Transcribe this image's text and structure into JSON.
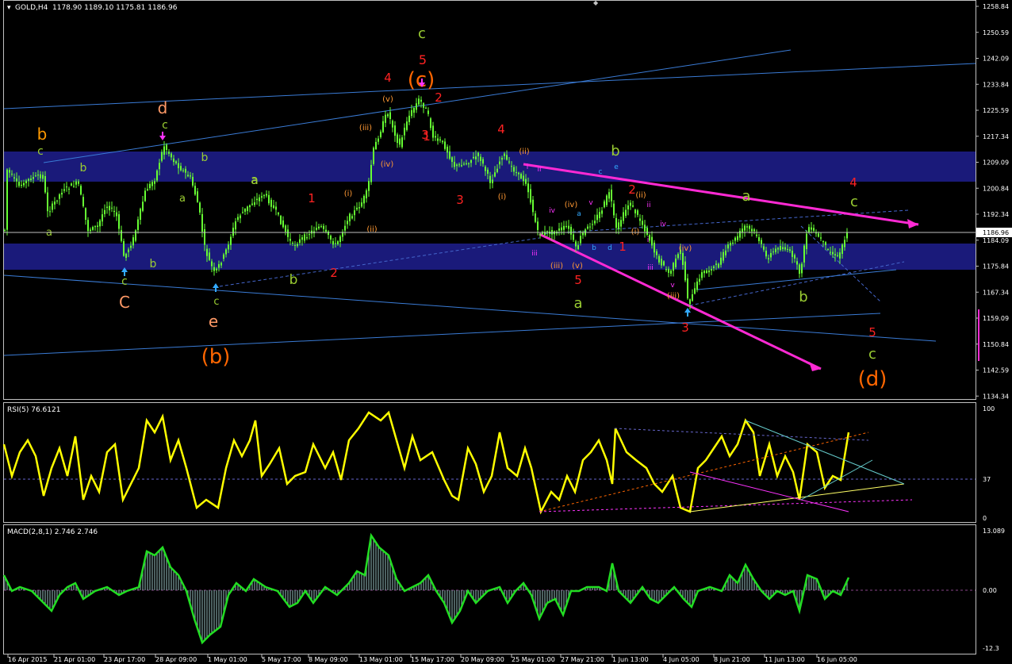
{
  "colors": {
    "background": "#000000",
    "frame": "#c0c0c0",
    "candle": "#66ff33",
    "zone": "#1a1a7a",
    "trend_line": "#3a7bd5",
    "magenta": "#ff2ad4",
    "rsi_line": "#ffff00",
    "macd_line": "#22dd22",
    "macd_hist": "#7fa0a0"
  },
  "main": {
    "title": "GOLD,H4",
    "ohlc": "1178.90 1189.10 1175.81 1186.96",
    "current_price": "1186.96",
    "price_ticks": [
      "1258.84",
      "1250.59",
      "1242.09",
      "1233.84",
      "1225.59",
      "1217.34",
      "1209.09",
      "1200.84",
      "1192.34",
      "1184.09",
      "1175.84",
      "1167.34",
      "1159.09",
      "1150.84",
      "1142.59",
      "1134.34"
    ]
  },
  "rsi": {
    "title": "RSI(5) 76.6121",
    "ticks": [
      "100",
      "37",
      "0"
    ]
  },
  "macd": {
    "title": "MACD(2,8,1) 2.746 2.746",
    "ticks": [
      "13.089",
      "0.00",
      "-12.3"
    ]
  },
  "time_axis": [
    "16 Apr 2015",
    "21 Apr 01:00",
    "23 Apr 17:00",
    "28 Apr 09:00",
    "1 May 01:00",
    "5 May 17:00",
    "8 May 09:00",
    "13 May 01:00",
    "15 May 17:00",
    "20 May 09:00",
    "25 May 01:00",
    "27 May 21:00",
    "1 Jun 13:00",
    "4 Jun 05:00",
    "8 Jun 21:00",
    "11 Jun 13:00",
    "16 Jun 05:00"
  ],
  "wave_labels": [
    {
      "t": "b",
      "c": "#ff9900",
      "s": 20
    },
    {
      "t": "c",
      "c": "#9acd32",
      "s": 14
    },
    {
      "t": "b",
      "c": "#9acd32",
      "s": 14
    },
    {
      "t": "a",
      "c": "#9acd32",
      "s": 13
    },
    {
      "t": "c",
      "c": "#9acd32",
      "s": 14
    },
    {
      "t": "C",
      "c": "#ff9966",
      "s": 20
    },
    {
      "t": "d",
      "c": "#ff9966",
      "s": 20
    },
    {
      "t": "c",
      "c": "#9acd32",
      "s": 14
    },
    {
      "t": "b",
      "c": "#9acd32",
      "s": 14
    },
    {
      "t": "a",
      "c": "#9acd32",
      "s": 13
    },
    {
      "t": "a",
      "c": "#9acd32",
      "s": 14
    },
    {
      "t": "b",
      "c": "#9acd32",
      "s": 14
    },
    {
      "t": "c",
      "c": "#9acd32",
      "s": 13
    },
    {
      "t": "e",
      "c": "#ff9966",
      "s": 20
    },
    {
      "t": "(b)",
      "c": "#ff6600",
      "s": 26
    },
    {
      "t": "a",
      "c": "#9acd32",
      "s": 16
    },
    {
      "t": "b",
      "c": "#9acd32",
      "s": 17
    },
    {
      "t": "1",
      "c": "#ff2222",
      "s": 15
    },
    {
      "t": "2",
      "c": "#ff2222",
      "s": 15
    },
    {
      "t": "(i)",
      "c": "#ff9933",
      "s": 10
    },
    {
      "t": "(ii)",
      "c": "#ff9933",
      "s": 10
    },
    {
      "t": "(iii)",
      "c": "#ff9933",
      "s": 10
    },
    {
      "t": "(iv)",
      "c": "#ff9933",
      "s": 10
    },
    {
      "t": "(v)",
      "c": "#ff9933",
      "s": 10
    },
    {
      "t": "3",
      "c": "#ff2222",
      "s": 15
    },
    {
      "t": "4",
      "c": "#ff2222",
      "s": 15
    },
    {
      "t": "5",
      "c": "#ff2222",
      "s": 16
    },
    {
      "t": "c",
      "c": "#9acd32",
      "s": 18
    },
    {
      "t": "(c)",
      "c": "#ff6600",
      "s": 26
    },
    {
      "t": "2",
      "c": "#ff2222",
      "s": 15
    },
    {
      "t": "1",
      "c": "#ff2222",
      "s": 15
    },
    {
      "t": "3",
      "c": "#ff2222",
      "s": 15
    },
    {
      "t": "4",
      "c": "#ff2222",
      "s": 15
    },
    {
      "t": "(ii)",
      "c": "#ff9933",
      "s": 10
    },
    {
      "t": "(i)",
      "c": "#ff9933",
      "s": 10
    },
    {
      "t": "ii",
      "c": "#ff33ff",
      "s": 9
    },
    {
      "t": "i",
      "c": "#ff33ff",
      "s": 9
    },
    {
      "t": "iii",
      "c": "#ff33ff",
      "s": 9
    },
    {
      "t": "iv",
      "c": "#ff33ff",
      "s": 9
    },
    {
      "t": "v",
      "c": "#ff33ff",
      "s": 9
    },
    {
      "t": "(iv)",
      "c": "#ff9933",
      "s": 10
    },
    {
      "t": "(iii)",
      "c": "#ff9933",
      "s": 10
    },
    {
      "t": "(v)",
      "c": "#ff9933",
      "s": 10
    },
    {
      "t": "5",
      "c": "#ff2222",
      "s": 15
    },
    {
      "t": "a",
      "c": "#9acd32",
      "s": 18
    },
    {
      "t": "a",
      "c": "#33aaff",
      "s": 9
    },
    {
      "t": "b",
      "c": "#33aaff",
      "s": 9
    },
    {
      "t": "c",
      "c": "#33aaff",
      "s": 9
    },
    {
      "t": "d",
      "c": "#33aaff",
      "s": 9
    },
    {
      "t": "e",
      "c": "#33aaff",
      "s": 9
    },
    {
      "t": "b",
      "c": "#9acd32",
      "s": 18
    },
    {
      "t": "2",
      "c": "#ff2222",
      "s": 15
    },
    {
      "t": "1",
      "c": "#ff2222",
      "s": 15
    },
    {
      "t": "(ii)",
      "c": "#ff9933",
      "s": 10
    },
    {
      "t": "(i)",
      "c": "#ff9933",
      "s": 10
    },
    {
      "t": "iii",
      "c": "#ff33ff",
      "s": 9
    },
    {
      "t": "iv",
      "c": "#ff33ff",
      "s": 9
    },
    {
      "t": "v",
      "c": "#ff33ff",
      "s": 9
    },
    {
      "t": "ii",
      "c": "#ff33ff",
      "s": 9
    },
    {
      "t": "i",
      "c": "#ff33ff",
      "s": 9
    },
    {
      "t": "(iv)",
      "c": "#ff9933",
      "s": 10
    },
    {
      "t": "(iii)",
      "c": "#ff9933",
      "s": 10
    },
    {
      "t": "3",
      "c": "#ff2222",
      "s": 15
    },
    {
      "t": "a",
      "c": "#9acd32",
      "s": 18
    },
    {
      "t": "b",
      "c": "#9acd32",
      "s": 18
    },
    {
      "t": "4",
      "c": "#ff2222",
      "s": 15
    },
    {
      "t": "c",
      "c": "#9acd32",
      "s": 18
    },
    {
      "t": "5",
      "c": "#ff2222",
      "s": 15
    },
    {
      "t": "c",
      "c": "#9acd32",
      "s": 18
    },
    {
      "t": "(d)",
      "c": "#ff6600",
      "s": 26
    }
  ]
}
